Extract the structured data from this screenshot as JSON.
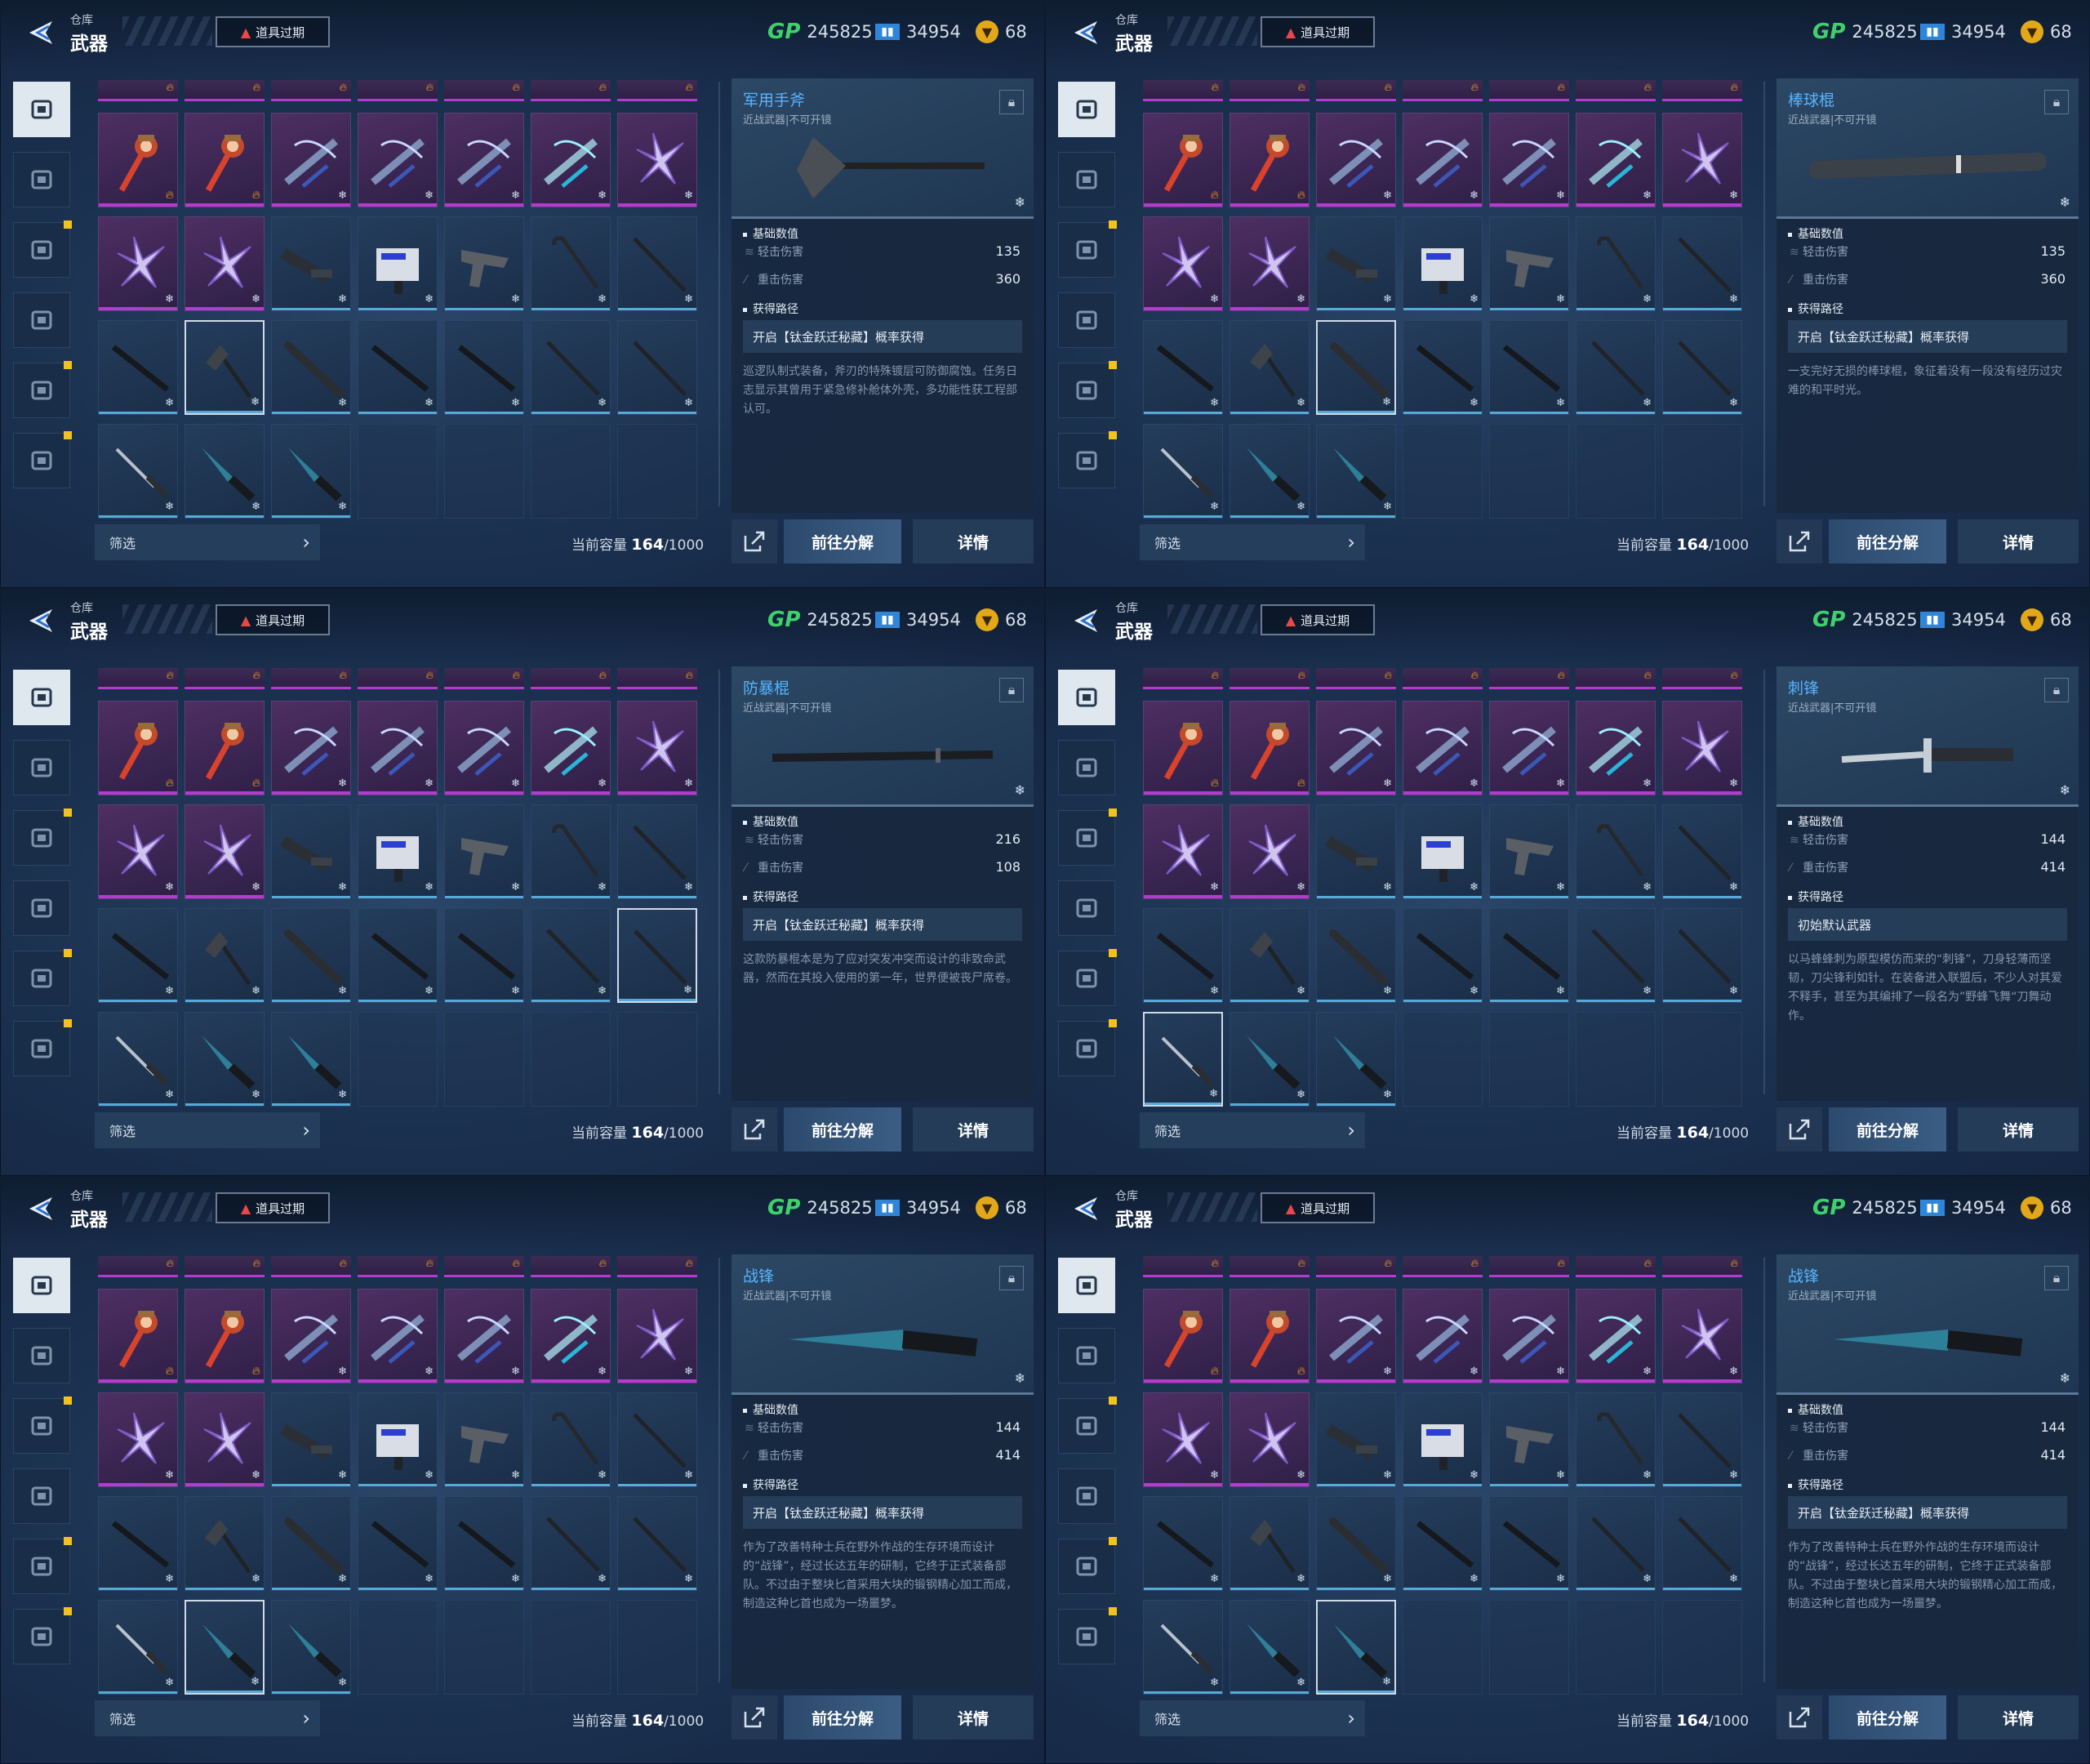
{
  "header": {
    "subtitle": "仓库",
    "title": "武器",
    "expired_label": "道具过期"
  },
  "currency": {
    "gp_label": "GP",
    "gp": "245825",
    "ticket_value": "34954",
    "coin_value": "68"
  },
  "side_tabs": [
    "pistol-icon",
    "armor-icon",
    "grenade-icon",
    "drone-icon",
    "skill-icon",
    "badge-icon"
  ],
  "filter_label": "筛选",
  "capacity": {
    "label": "当前容量",
    "current": "164",
    "max": "/1000"
  },
  "sections": {
    "stats": "基础数值",
    "source": "获得路径"
  },
  "stat_labels": {
    "light": "轻击伤害",
    "heavy": "重击伤害"
  },
  "buttons": {
    "decompose": "前往分解",
    "details": "详情"
  },
  "panels": [
    {
      "name": "军用手斧",
      "sub": "近战武器|不可开镜",
      "light": "135",
      "heavy": "360",
      "source": "开启【钛金跃迁秘藏】概率获得",
      "desc": "巡逻队制式装备，斧刃的特殊镀层可防御腐蚀。任务日志显示其曾用于紧急修补舱体外壳，多功能性获工程部认可。",
      "weapon": "axe",
      "selected": "r3c2"
    },
    {
      "name": "棒球棍",
      "sub": "近战武器|不可开镜",
      "light": "135",
      "heavy": "360",
      "source": "开启【钛金跃迁秘藏】概率获得",
      "desc": "一支完好无损的棒球棍，象征着没有一段没有经历过灾难的和平时光。",
      "weapon": "bat",
      "selected": "r3c3"
    },
    {
      "name": "防暴棍",
      "sub": "近战武器|不可开镜",
      "light": "216",
      "heavy": "108",
      "source": "开启【钛金跃迁秘藏】概率获得",
      "desc": "这款防暴棍本是为了应对突发冲突而设计的非致命武器，然而在其投入使用的第一年，世界便被丧尸席卷。",
      "weapon": "baton",
      "selected": "r3c7"
    },
    {
      "name": "刺锋",
      "sub": "近战武器|不可开镜",
      "light": "144",
      "heavy": "414",
      "source": "初始默认武器",
      "desc": "以马蜂蜂刺为原型模仿而来的“刺锋”，刀身轻薄而坚韧，刀尖锋利如针。在装备进入联盟后，不少人对其爱不释手，甚至为其编排了一段名为”野蜂飞舞“刀舞动作。",
      "weapon": "stiletto",
      "selected": "r4c1"
    },
    {
      "name": "战锋",
      "sub": "近战武器|不可开镜",
      "light": "144",
      "heavy": "414",
      "source": "开启【钛金跃迁秘藏】概率获得",
      "desc": "作为了改善特种士兵在野外作战的生存环境而设计的“战锋”，经过长达五年的研制，它终于正式装备部队。不过由于整块匕首采用大块的锻钢精心加工而成，制造这种匕首也成为一场噩梦。",
      "weapon": "combat",
      "selected": "r4c2"
    },
    {
      "name": "战锋",
      "sub": "近战武器|不可开镜",
      "light": "144",
      "heavy": "414",
      "source": "开启【钛金跃迁秘藏】概率获得",
      "desc": "作为了改善特种士兵在野外作战的生存环境而设计的“战锋”，经过长达五年的研制，它终于正式装备部队。不过由于整块匕首采用大块的锻钢精心加工而成，制造这种匕首也成为一场噩梦。",
      "weapon": "combat",
      "selected": "r4c3"
    }
  ],
  "grid_rows": [
    [
      "hammer-red",
      "hammer-red",
      "crossbow",
      "crossbow",
      "crossbow",
      "crossbow-cyan",
      "shuriken"
    ],
    [
      "shuriken",
      "shuriken",
      "shotgun",
      "smg",
      "pistol",
      "crowbar",
      "stick"
    ],
    [
      "baton",
      "axe",
      "bat",
      "baton",
      "baton",
      "stick",
      "stick"
    ],
    [
      "stiletto",
      "combat",
      "combat",
      "empty",
      "empty",
      "empty",
      "empty"
    ]
  ]
}
